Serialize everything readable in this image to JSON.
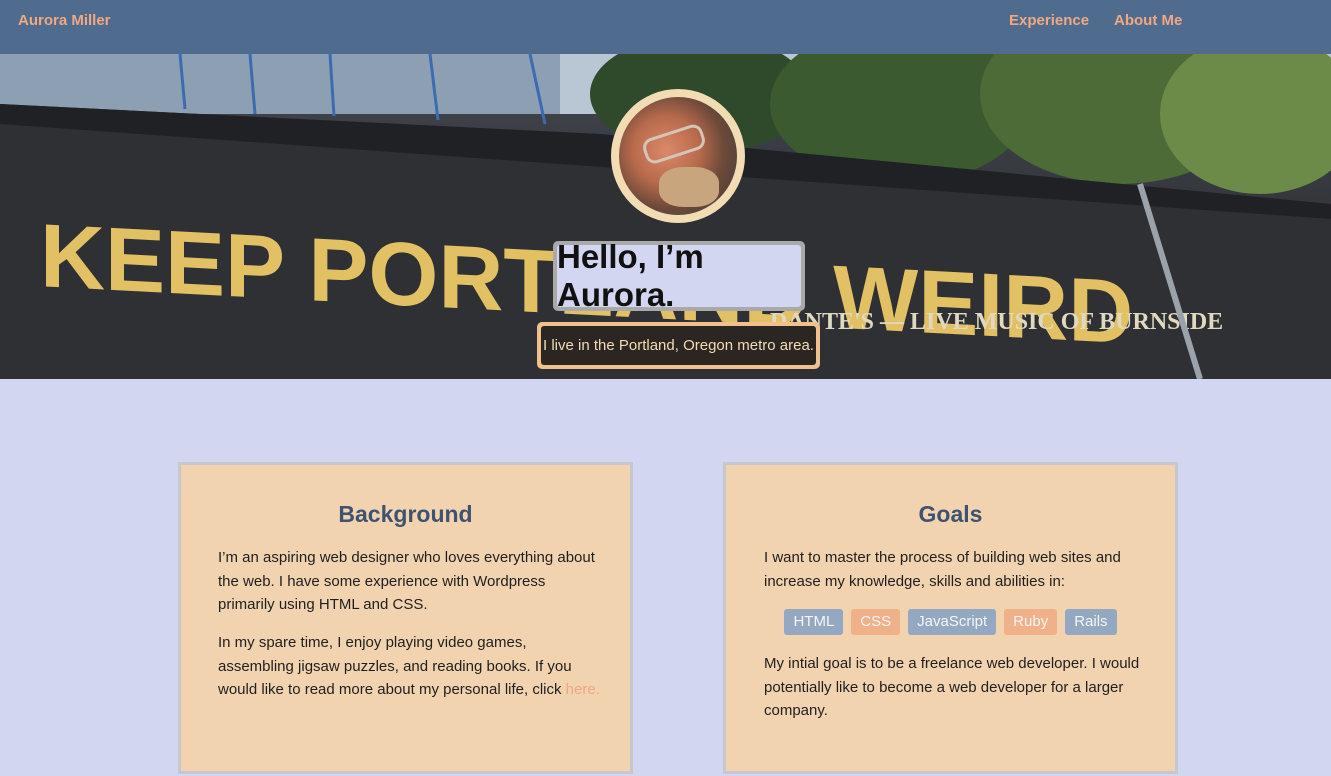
{
  "nav": {
    "brand": "Aurora Miller",
    "links": [
      "Experience",
      "About Me"
    ]
  },
  "hero": {
    "sign_text": "KEEP PORTLAND WEIRD",
    "sign_subtext": "DANTE'S — LIVE MUSIC OF BURNSIDE",
    "heading": "Hello, I’m Aurora.",
    "subheading": "I live in the Portland, Oregon metro area."
  },
  "background": {
    "title": "Background",
    "para1": "I’m an aspiring web designer who loves everything about the web. I have some experience with Wordpress primarily using HTML and CSS.",
    "para2": "In my spare time, I enjoy playing video games, assembling jigsaw puzzles, and reading books. If you would like to read more about my personal life, click ",
    "link": "here."
  },
  "goals": {
    "title": "Goals",
    "para1": "I want to master the process of building web sites and increase my knowledge, skills and abilities in:",
    "tags": [
      "HTML",
      "CSS",
      "JavaScript",
      "Ruby",
      "Rails"
    ],
    "para2": "My intial goal is to be a freelance web developer. I would potentially like to become a web developer for a larger company."
  },
  "colors": {
    "navbar": "#4f6b8e",
    "accent": "#f0a882",
    "page_bg": "#d3d6f1",
    "card_bg": "#f2d3b0",
    "title": "#3f5270"
  }
}
